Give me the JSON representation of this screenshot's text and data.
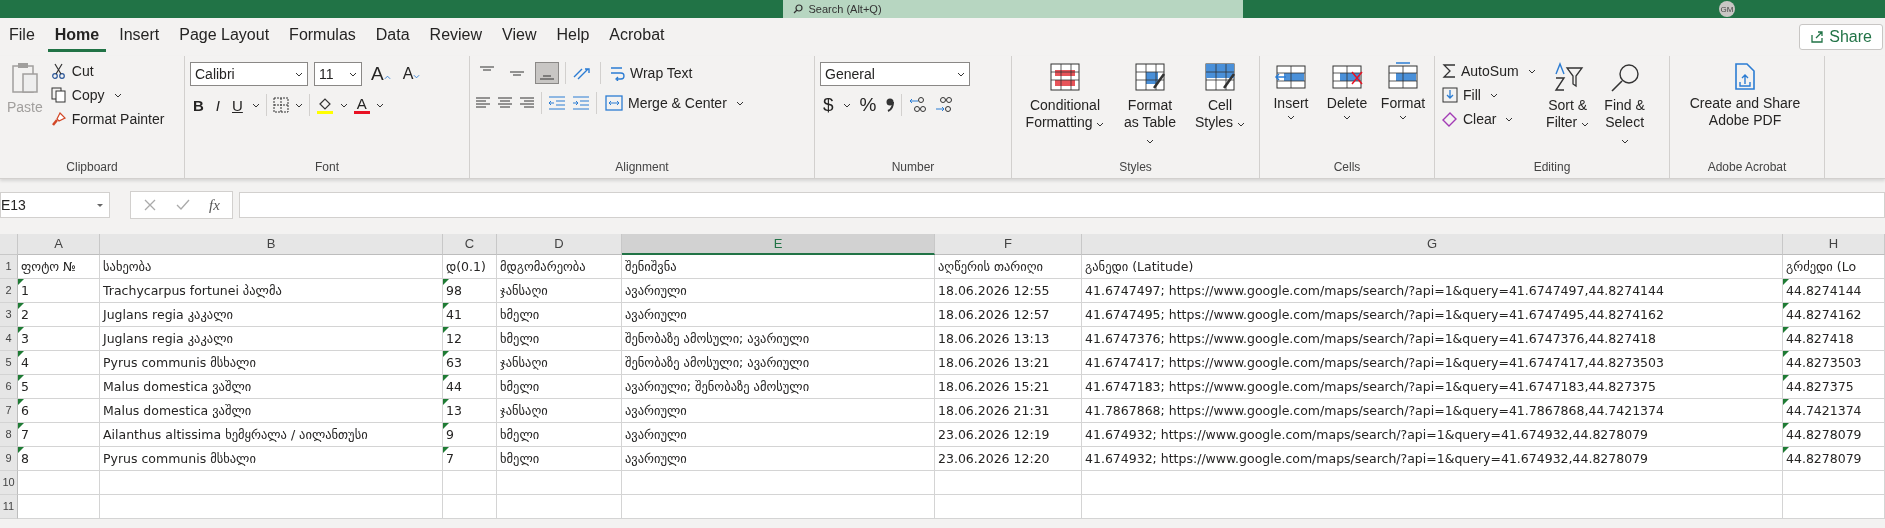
{
  "title_bar": {
    "search_placeholder": "Search (Alt+Q)",
    "user_initials": "GM"
  },
  "menu_tabs": [
    {
      "label": "File",
      "selected": false
    },
    {
      "label": "Home",
      "selected": true
    },
    {
      "label": "Insert",
      "selected": false
    },
    {
      "label": "Page Layout",
      "selected": false
    },
    {
      "label": "Formulas",
      "selected": false
    },
    {
      "label": "Data",
      "selected": false
    },
    {
      "label": "Review",
      "selected": false
    },
    {
      "label": "View",
      "selected": false
    },
    {
      "label": "Help",
      "selected": false
    },
    {
      "label": "Acrobat",
      "selected": false
    }
  ],
  "share_button": "Share",
  "clipboard": {
    "title": "Clipboard",
    "paste": "Paste",
    "paste_disabled": true,
    "cut": "Cut",
    "copy": "Copy",
    "format_painter": "Format Painter"
  },
  "font": {
    "title": "Font",
    "font_name": "Calibri",
    "font_size": "11",
    "grow": "A",
    "shrink": "A",
    "bold": "B",
    "italic": "I",
    "underline": "U",
    "font_color_letter": "A"
  },
  "alignment": {
    "title": "Alignment",
    "vertical_align": [
      {
        "selected": false
      },
      {
        "selected": false
      },
      {
        "selected": true
      }
    ],
    "wrap_text": "Wrap Text",
    "merge_center": "Merge & Center"
  },
  "number": {
    "title": "Number",
    "format": "General",
    "currency": "$",
    "percent": "%"
  },
  "styles": {
    "title": "Styles",
    "buttons": [
      {
        "kind": "conditional",
        "label": "Conditional Formatting"
      },
      {
        "kind": "table",
        "label": "Format as Table"
      },
      {
        "kind": "cell",
        "label": "Cell Styles"
      }
    ]
  },
  "cells": {
    "title": "Cells",
    "buttons": [
      {
        "kind": "insert",
        "label": "Insert"
      },
      {
        "kind": "delete",
        "label": "Delete"
      },
      {
        "kind": "format",
        "label": "Format"
      }
    ]
  },
  "editing": {
    "title": "Editing",
    "autosum": "AutoSum",
    "fill": "Fill",
    "clear": "Clear",
    "sort_filter": "Sort & Filter",
    "find_select": "Find & Select"
  },
  "acrobat": {
    "title": "Adobe Acrobat",
    "create_pdf": "Create and Share Adobe PDF"
  },
  "formula_bar": {
    "name_box": "E13",
    "function_label": "fx"
  },
  "sheet": {
    "columns": [
      {
        "letter": "A",
        "selected": false
      },
      {
        "letter": "B",
        "selected": false
      },
      {
        "letter": "C",
        "selected": false
      },
      {
        "letter": "D",
        "selected": false
      },
      {
        "letter": "E",
        "selected": true
      },
      {
        "letter": "F",
        "selected": false
      },
      {
        "letter": "G",
        "selected": false
      },
      {
        "letter": "H",
        "selected": false
      }
    ],
    "rows": [
      {
        "number": "1",
        "flagged": false,
        "cells": [
          "ფოტო №",
          "სახეობა",
          "დ(0.1)",
          "მდგომარეობა",
          "შენიშვნა",
          "აღწერის თარიღი",
          "განედი (Latitude)",
          "გრძედი (Lo"
        ]
      },
      {
        "number": "2",
        "flagged": true,
        "cells": [
          "1",
          "Trachycarpus fortunei პალმა",
          "98",
          "ჯანსაღი",
          "ავარიული",
          "18.06.2026 12:55",
          "41.6747497; https://www.google.com/maps/search/?api=1&query=41.6747497,44.8274144",
          "44.8274144"
        ]
      },
      {
        "number": "3",
        "flagged": true,
        "cells": [
          "2",
          "Juglans regia კაკალი",
          "41",
          "ხმელი",
          "ავარიული",
          "18.06.2026 12:57",
          "41.6747495; https://www.google.com/maps/search/?api=1&query=41.6747495,44.8274162",
          "44.8274162"
        ]
      },
      {
        "number": "4",
        "flagged": true,
        "cells": [
          "3",
          "Juglans regia კაკალი",
          "12",
          "ხმელი",
          "შენობაზე ამოსული; ავარიული",
          "18.06.2026 13:13",
          "41.6747376; https://www.google.com/maps/search/?api=1&query=41.6747376,44.827418",
          "44.827418"
        ]
      },
      {
        "number": "5",
        "flagged": true,
        "cells": [
          "4",
          "Pyrus communis მსხალი",
          "63",
          "ჯანსაღი",
          "შენობაზე ამოსული; ავარიული",
          "18.06.2026 13:21",
          "41.6747417; https://www.google.com/maps/search/?api=1&query=41.6747417,44.8273503",
          "44.8273503"
        ]
      },
      {
        "number": "6",
        "flagged": true,
        "cells": [
          "5",
          "Malus domestica ვაშლი",
          "44",
          "ხმელი",
          "ავარიული; შენობაზე ამოსული",
          "18.06.2026 15:21",
          "41.6747183; https://www.google.com/maps/search/?api=1&query=41.6747183,44.827375",
          "44.827375"
        ]
      },
      {
        "number": "7",
        "flagged": true,
        "cells": [
          "6",
          "Malus domestica ვაშლი",
          "13",
          "ჯანსაღი",
          "ავარიული",
          "18.06.2026 21:31",
          "41.7867868; https://www.google.com/maps/search/?api=1&query=41.7867868,44.7421374",
          "44.7421374"
        ]
      },
      {
        "number": "8",
        "flagged": true,
        "cells": [
          "7",
          "Ailanthus altissima ხემყრალა / აილანთუსი",
          "9",
          "ხმელი",
          "ავარიული",
          "23.06.2026 12:19",
          "41.674932; https://www.google.com/maps/search/?api=1&query=41.674932,44.8278079",
          "44.8278079"
        ]
      },
      {
        "number": "9",
        "flagged": true,
        "cells": [
          "8",
          "Pyrus communis მსხალი",
          "7",
          "ხმელი",
          "ავარიული",
          "23.06.2026 12:20",
          "41.674932; https://www.google.com/maps/search/?api=1&query=41.674932,44.8278079",
          "44.8278079"
        ]
      },
      {
        "number": "10",
        "flagged": false
      },
      {
        "number": "11",
        "flagged": false
      }
    ]
  }
}
